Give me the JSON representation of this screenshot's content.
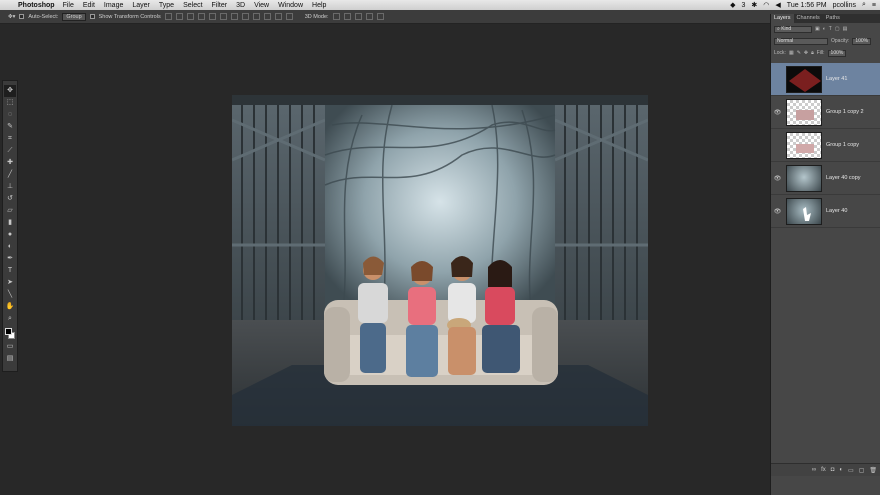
{
  "menubar": {
    "app_name": "Photoshop",
    "items": [
      "File",
      "Edit",
      "Image",
      "Layer",
      "Type",
      "Select",
      "Filter",
      "3D",
      "View",
      "Window",
      "Help"
    ],
    "clock": "Tue 1:56 PM",
    "user": "pcollins",
    "badge": "3"
  },
  "options_bar": {
    "auto_select_label": "Auto-Select:",
    "auto_select_value": "Group",
    "show_transform_label": "Show Transform Controls",
    "mode_3d_label": "3D Mode:"
  },
  "layers_panel": {
    "tabs": [
      "Layers",
      "Channels",
      "Paths"
    ],
    "filter_kind": "Kind",
    "blend_mode": "Normal",
    "opacity_label": "Opacity:",
    "opacity_value": "100%",
    "lock_label": "Lock:",
    "fill_label": "Fill:",
    "fill_value": "100%",
    "layers": [
      {
        "name": "Layer 41",
        "visible": false,
        "selected": true
      },
      {
        "name": "Group 1 copy 2",
        "visible": true,
        "selected": false
      },
      {
        "name": "Group 1 copy",
        "visible": false,
        "selected": false
      },
      {
        "name": "Layer 40 copy",
        "visible": true,
        "selected": false
      },
      {
        "name": "Layer 40",
        "visible": true,
        "selected": false
      }
    ],
    "bottom_icons": [
      "link-icon",
      "fx-icon",
      "mask-icon",
      "adjustment-icon",
      "folder-icon",
      "new-layer-icon",
      "trash-icon"
    ]
  },
  "tools": [
    "move",
    "marquee",
    "lasso",
    "quick-select",
    "crop",
    "eyedropper",
    "healing",
    "brush",
    "stamp",
    "history-brush",
    "eraser",
    "gradient",
    "blur",
    "dodge",
    "pen",
    "type",
    "path-select",
    "shape",
    "hand",
    "zoom"
  ],
  "colors": {
    "accent_selected": "#6d83a0",
    "panel_bg": "#474747",
    "workspace_bg": "#282828"
  }
}
